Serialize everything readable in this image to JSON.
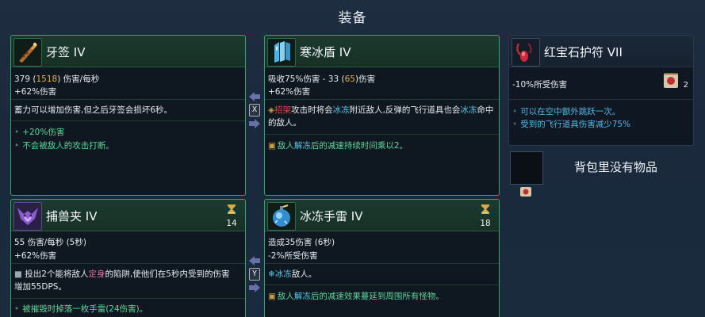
{
  "header": {
    "title": "装备"
  },
  "cards": {
    "fang": {
      "name": "牙签 IV",
      "stat1_pre": "379 (",
      "stat1_val": "1518",
      "stat1_post": ") 伤害/每秒",
      "stat2": "+62%伤害",
      "desc": "蓄力可以增加伤害,但之后牙签会损坏6秒。",
      "perk1": "+20%伤害",
      "perk2": "不会被敌人的攻击打断。"
    },
    "ice_shield": {
      "name": "寒冰盾 IV",
      "stat1_pre": "吸收75%伤害 - 33 (",
      "stat1_val": "65",
      "stat1_post": ")伤害",
      "stat2": "+62%伤害",
      "desc_kw1": "招架",
      "desc_a": "攻击时将会",
      "desc_kw2": "冰冻",
      "desc_b": "附近敌人,反弹的飞行道具也会",
      "desc_kw3": "冰冻",
      "desc_c": "命中的敌人。",
      "perk_pre": "敌人",
      "perk_kw": "解冻",
      "perk_post": "后的减速持续时间乘以2。"
    },
    "trap": {
      "name": "捕兽夹 IV",
      "cooldown": "14",
      "stat1": "55 伤害/每秒 (5秒)",
      "stat2": "+62%伤害",
      "desc_a": "投出2个能将敌人",
      "desc_kw": "定身",
      "desc_b": "的陷阱,使他们在5秒内受到的伤害",
      "desc_c": "增加55DPS。",
      "perk1": "被摧毁时掉落一枚手雷(24伤害)。"
    },
    "grenade": {
      "name": "冰冻手雷 IV",
      "cooldown": "18",
      "stat1": "造成35伤害 (6秒)",
      "stat2": "-2%所受伤害",
      "desc_kw": "冰冻",
      "desc_post": "敌人。",
      "perk_pre": "敌人",
      "perk_kw": "解冻",
      "perk_post": "后的减速效果蔓延到周围所有怪物。"
    },
    "ruby": {
      "name": "红宝石护符 VII",
      "stat1": "-10%所受伤害",
      "badge_count": "2",
      "perk1": "可以在空中额外跳跃一次。",
      "perk2": "受到的飞行道具伤害减少75%"
    }
  },
  "keys": {
    "swap_top": "X",
    "swap_bottom": "Y"
  },
  "backpack": {
    "empty_text": "背包里没有物品"
  }
}
